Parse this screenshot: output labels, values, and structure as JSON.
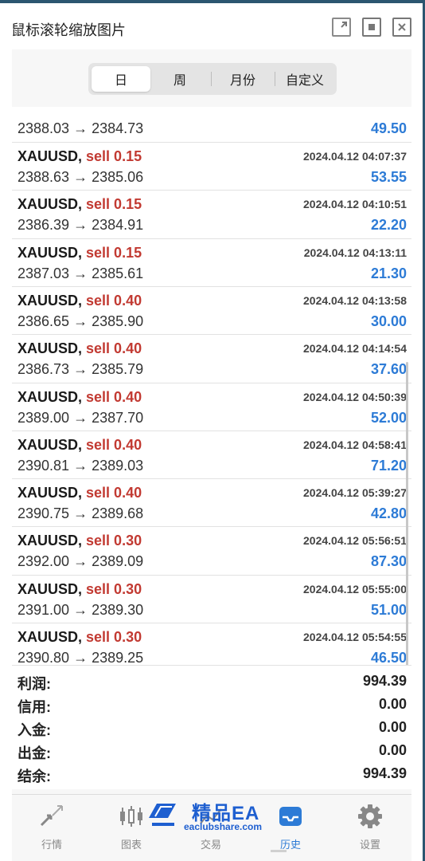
{
  "window": {
    "title": "鼠标滚轮缩放图片",
    "buttons": [
      "popout",
      "fit",
      "close"
    ]
  },
  "period_tabs": {
    "items": [
      "日",
      "周",
      "月份",
      "自定义"
    ],
    "active": "日"
  },
  "trades": {
    "partial_top": {
      "price": "2388.03 → 2384.73",
      "profit": "49.50"
    },
    "rows": [
      {
        "symbol": "XAUUSD,",
        "side": "sell 0.15",
        "time": "2024.04.12 04:07:37",
        "price": "2388.63 → 2385.06",
        "profit": "53.55"
      },
      {
        "symbol": "XAUUSD,",
        "side": "sell 0.15",
        "time": "2024.04.12 04:10:51",
        "price": "2386.39 → 2384.91",
        "profit": "22.20"
      },
      {
        "symbol": "XAUUSD,",
        "side": "sell 0.15",
        "time": "2024.04.12 04:13:11",
        "price": "2387.03 → 2385.61",
        "profit": "21.30"
      },
      {
        "symbol": "XAUUSD,",
        "side": "sell 0.40",
        "time": "2024.04.12 04:13:58",
        "price": "2386.65 → 2385.90",
        "profit": "30.00"
      },
      {
        "symbol": "XAUUSD,",
        "side": "sell 0.40",
        "time": "2024.04.12 04:14:54",
        "price": "2386.73 → 2385.79",
        "profit": "37.60"
      },
      {
        "symbol": "XAUUSD,",
        "side": "sell 0.40",
        "time": "2024.04.12 04:50:39",
        "price": "2389.00 → 2387.70",
        "profit": "52.00"
      },
      {
        "symbol": "XAUUSD,",
        "side": "sell 0.40",
        "time": "2024.04.12 04:58:41",
        "price": "2390.81 → 2389.03",
        "profit": "71.20"
      },
      {
        "symbol": "XAUUSD,",
        "side": "sell 0.40",
        "time": "2024.04.12 05:39:27",
        "price": "2390.75 → 2389.68",
        "profit": "42.80"
      },
      {
        "symbol": "XAUUSD,",
        "side": "sell 0.30",
        "time": "2024.04.12 05:56:51",
        "price": "2392.00 → 2389.09",
        "profit": "87.30"
      },
      {
        "symbol": "XAUUSD,",
        "side": "sell 0.30",
        "time": "2024.04.12 05:55:00",
        "price": "2391.00 → 2389.30",
        "profit": "51.00"
      },
      {
        "symbol": "XAUUSD,",
        "side": "sell 0.30",
        "time": "2024.04.12 05:54:55",
        "price": "2390.80 → 2389.25",
        "profit": "46.50"
      }
    ]
  },
  "summary": {
    "profit_label": "利润:",
    "profit": "994.39",
    "credit_label": "信用:",
    "credit": "0.00",
    "deposit_label": "入金:",
    "deposit": "0.00",
    "withdrawal_label": "出金:",
    "withdrawal": "0.00",
    "balance_label": "结余:",
    "balance": "994.39"
  },
  "nav": {
    "items": [
      {
        "label": "行情",
        "icon": "quotes-arrows-icon"
      },
      {
        "label": "图表",
        "icon": "candlestick-chart-icon"
      },
      {
        "label": "交易",
        "icon": "trade-chart-icon"
      },
      {
        "label": "历史",
        "icon": "history-inbox-icon"
      },
      {
        "label": "设置",
        "icon": "gear-icon"
      }
    ],
    "active": "历史"
  },
  "watermark": {
    "title": "精品EA",
    "url": "eaclubshare.com"
  },
  "colors": {
    "sell": "#c23a32",
    "profit": "#2d7bd6",
    "active_nav": "#2d7bd6",
    "frame": "#2c5670"
  }
}
